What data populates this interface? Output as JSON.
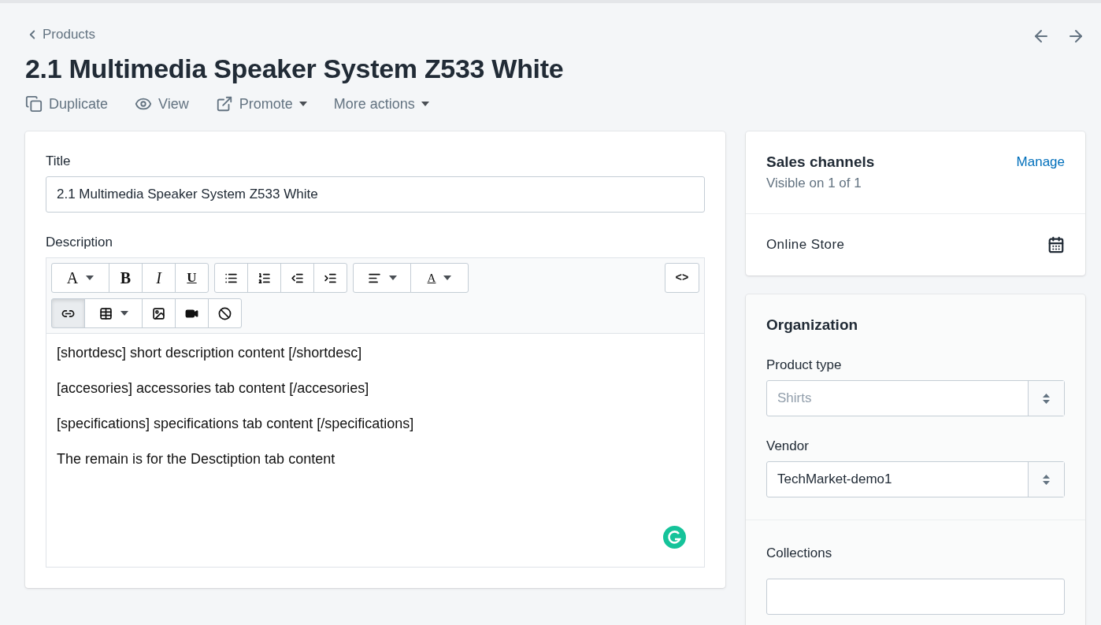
{
  "breadcrumb": {
    "label": "Products"
  },
  "page_title": "2.1 Multimedia Speaker System Z533 White",
  "actions": [
    {
      "kind": "duplicate",
      "label": "Duplicate",
      "dropdown": false
    },
    {
      "kind": "view",
      "label": "View",
      "dropdown": false
    },
    {
      "kind": "promote",
      "label": "Promote",
      "dropdown": true
    },
    {
      "kind": "more",
      "label": "More actions",
      "dropdown": true
    }
  ],
  "product": {
    "title_label": "Title",
    "title_value": "2.1 Multimedia Speaker System Z533 White",
    "description_label": "Description",
    "toolbar_rows": [
      [
        [
          {
            "kind": "font",
            "label": "A",
            "dropdown": true,
            "active": false
          },
          {
            "kind": "bold",
            "label": "B",
            "dropdown": false,
            "active": false
          },
          {
            "kind": "italic",
            "label": "I",
            "dropdown": false,
            "active": false
          },
          {
            "kind": "underline",
            "label": "U",
            "dropdown": false,
            "active": false
          }
        ],
        [
          {
            "kind": "bullets",
            "dropdown": false,
            "active": false
          },
          {
            "kind": "numbers",
            "dropdown": false,
            "active": false
          },
          {
            "kind": "outdent",
            "dropdown": false,
            "active": false
          },
          {
            "kind": "indent",
            "dropdown": false,
            "active": false
          }
        ],
        [
          {
            "kind": "align",
            "dropdown": true,
            "active": false
          },
          {
            "kind": "color",
            "label": "A",
            "dropdown": true,
            "active": false
          }
        ]
      ],
      [
        [
          {
            "kind": "link",
            "dropdown": false,
            "active": true
          },
          {
            "kind": "table",
            "dropdown": true,
            "active": false
          },
          {
            "kind": "image",
            "dropdown": false,
            "active": false
          },
          {
            "kind": "video",
            "dropdown": false,
            "active": false
          },
          {
            "kind": "clear",
            "dropdown": false,
            "active": false
          }
        ]
      ]
    ],
    "code_button": {
      "label": "<>"
    },
    "description_paragraphs": [
      "[shortdesc] short description content [/shortdesc]",
      "[accesories] accessories tab content [/accesories]",
      "[specifications] specifications tab content [/specifications]",
      "The remain is for the Desctiption tab content"
    ]
  },
  "sales_channels": {
    "title": "Sales channels",
    "subtitle": "Visible on 1 of 1",
    "manage": "Manage",
    "channels": [
      {
        "name": "Online Store"
      }
    ]
  },
  "organization": {
    "title": "Organization",
    "product_type": {
      "label": "Product type",
      "placeholder": "Shirts"
    },
    "vendor": {
      "label": "Vendor",
      "value": "TechMarket-demo1"
    },
    "collections_label": "Collections"
  }
}
